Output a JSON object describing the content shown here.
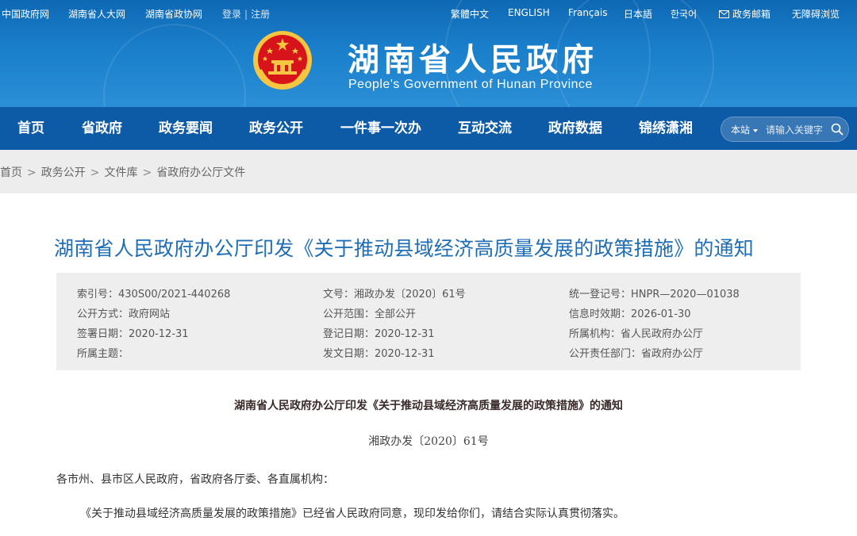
{
  "topbar": {
    "links": [
      "中国政府网",
      "湖南省人大网",
      "湖南省政协网"
    ],
    "login": "登录",
    "sep": "|",
    "register": "注册",
    "languages": [
      "繁體中文",
      "ENGLISH",
      "Français",
      "日本語",
      "한국어"
    ],
    "mail": "政务邮箱",
    "accessible": "无障碍浏览"
  },
  "site": {
    "title": "湖南省人民政府",
    "subtitle": "People's Government of Hunan Province"
  },
  "nav": {
    "items": [
      "首页",
      "省政府",
      "政务要闻",
      "政务公开",
      "一件事一次办",
      "互动交流",
      "政府数据",
      "锦绣潇湘"
    ],
    "search_scope": "本站",
    "search_placeholder": "请输入关键字"
  },
  "breadcrumb": [
    "首页",
    "政务公开",
    "文件库",
    "省政府办公厅文件"
  ],
  "breadcrumb_sep": ">",
  "article": {
    "title": "湖南省人民政府办公厅印发《关于推动县域经济高质量发展的政策措施》的通知",
    "meta": [
      [
        "索引号：430S00/2021-440268",
        "文号：湘政办发〔2020〕61号",
        "统一登记号：HNPR—2020—01038"
      ],
      [
        "公开方式：政府网站",
        "公开范围：全部公开",
        "信息时效期：2026-01-30"
      ],
      [
        "签署日期：2020-12-31",
        "登记日期：2020-12-31",
        "所属机构：省人民政府办公厅"
      ],
      [
        "所属主题：",
        "发文日期：2020-12-31",
        "公开责任部门：省政府办公厅"
      ]
    ],
    "doc_heading": "湖南省人民政府办公厅印发《关于推动县域经济高质量发展的政策措施》的通知",
    "doc_number": "湘政办发〔2020〕61号",
    "para1": "各市州、县市区人民政府，省政府各厅委、各直属机构：",
    "para2": "《关于推动县域经济高质量发展的政策措施》已经省人民政府同意，现印发给你们，请结合实际认真贯彻落实。"
  },
  "colors": {
    "header_blue": "#1a7fcb",
    "nav_blue": "#0d5aa7",
    "title_blue": "#1f6db5",
    "emblem_red": "#d7141a",
    "emblem_gold": "#f6c542"
  }
}
